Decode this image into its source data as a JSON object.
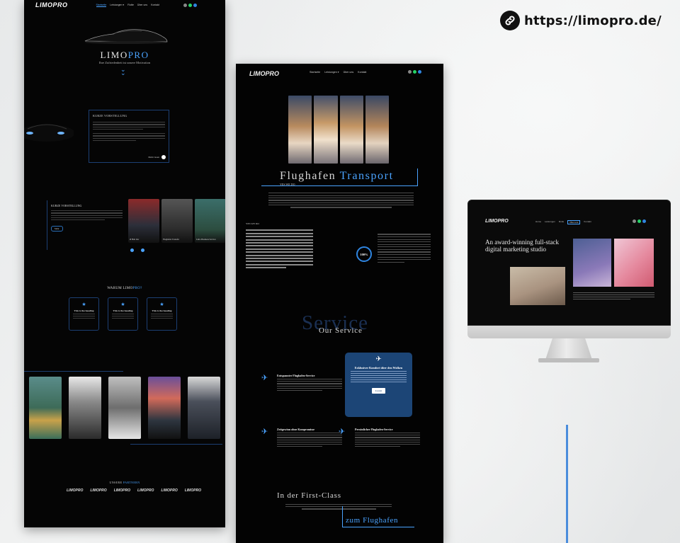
{
  "site": {
    "url": "https://limopro.de/",
    "icon": "link-icon"
  },
  "colors": {
    "accent": "#4aa3ff",
    "page_bg": "#eceeef",
    "dark_bg": "#050505",
    "feature_blue": "#1c4576"
  },
  "page1": {
    "logo": "LIMOPRO",
    "nav": [
      "Startseite",
      "Leistungen ▾",
      "Flotte",
      "Über uns",
      "Kontakt"
    ],
    "brand_main": "LIMO",
    "brand_accent": "PRO",
    "tagline": "Ihre Zufriedenheit ist unsere Motivation",
    "box1_heading": "KURZE VORSTELLUNG",
    "box1_more": "Mehr lesen",
    "box2_heading": "KURZE VORSTELLUNG",
    "box2_button": "Mehr",
    "tiles": [
      "Ø Hub Zur",
      "Flughafen Transfer",
      "Limo Business Service"
    ],
    "warum_main": "WARUM LIMO",
    "warum_accent": "PRO?",
    "cards": [
      "This is the heading",
      "This is the heading",
      "This is the heading"
    ],
    "unsere_main": "UNSERE",
    "unsere_accent": "PARTNERN",
    "partners": [
      "LIMOPRO",
      "LIMOPRO",
      "LIMOPRO",
      "LIMOPRO",
      "LIMOPRO",
      "LIMOPRO"
    ]
  },
  "page2": {
    "logo": "LIMOPRO",
    "nav": [
      "Startseite",
      "Leistungen ▾",
      "Über uns",
      "Kontakt"
    ],
    "title_main": "Flughafen",
    "title_accent": "Transport",
    "yes_we_do": "YES WE DO",
    "yes_we_do_2": "YES WE DO",
    "percent": "100%",
    "service_big": "Service",
    "service_small": "Our Service",
    "services": [
      "Entspannter Flughafen-Service",
      "Zeitgewinn ohne Kompromisse",
      "Persönlicher Flughafen-Service"
    ],
    "feature_heading": "Exklusiver Komfort über den Wolken",
    "feature_button": "Kontakt",
    "first_class": "In der First-Class",
    "zum_flughafen": "zum Flughafen"
  },
  "imac": {
    "logo": "LIMOPRO",
    "nav": [
      "Home",
      "Leistungen",
      "Flotte",
      "Über uns",
      "Kontakt"
    ],
    "active_nav": "Über uns",
    "heading": "An award-winning full-stack digital marketing studio"
  }
}
